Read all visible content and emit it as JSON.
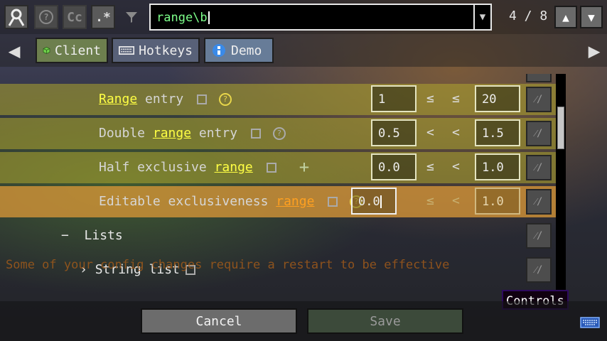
{
  "toolbar": {
    "search_text": "range\\b",
    "match_count": "4 / 8",
    "case_label": "Cc",
    "regex_label": ".*"
  },
  "tabs": [
    {
      "label": "Client",
      "icon": "cube-icon"
    },
    {
      "label": "Hotkeys",
      "icon": "keyboard-icon"
    },
    {
      "label": "Demo",
      "icon": "globe-icon"
    }
  ],
  "entries": [
    {
      "pre": "",
      "match": "Range",
      "post": " entry",
      "min": "1",
      "op1": "≤",
      "op2": "≤",
      "max": "20"
    },
    {
      "pre": "Double ",
      "match": "range",
      "post": " entry",
      "min": "0.5",
      "op1": "<",
      "op2": "<",
      "max": "1.5"
    },
    {
      "pre": "Half exclusive ",
      "match": "range",
      "post": "",
      "min": "0.0",
      "op1": "≤",
      "op2": "<",
      "max": "1.0"
    },
    {
      "pre": "Editable exclusiveness ",
      "match": "range",
      "post": "",
      "min": "0.0",
      "op1": "≤",
      "op2": "<",
      "max": "1.0"
    }
  ],
  "category": {
    "collapse_symbol": "−",
    "label": "Lists"
  },
  "subcategory": {
    "expand_symbol": "›",
    "label": "String list"
  },
  "warning": "Some of your config changes require a restart to be effective",
  "tooltip": "Controls",
  "buttons": {
    "cancel": "Cancel",
    "save": "Save"
  },
  "colors": {
    "highlight_row": "#afa52d",
    "selected_row": "#d79637",
    "match_text": "#ffff44",
    "selected_match_text": "#ffa020",
    "search_text": "#7dff8a"
  }
}
